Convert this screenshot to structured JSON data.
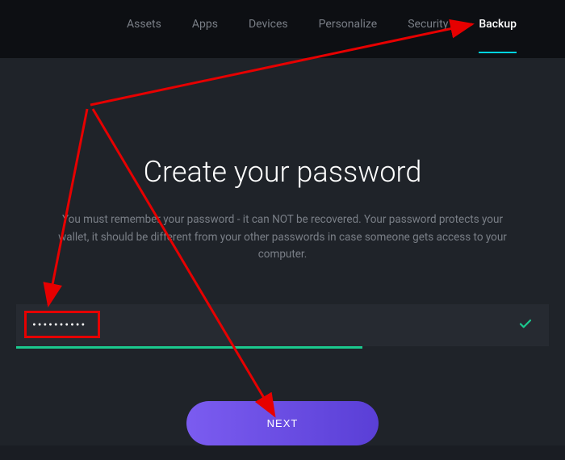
{
  "tabs": {
    "items": [
      {
        "label": "Assets"
      },
      {
        "label": "Apps"
      },
      {
        "label": "Devices"
      },
      {
        "label": "Personalize"
      },
      {
        "label": "Security"
      },
      {
        "label": "Backup"
      }
    ],
    "active_index": 5
  },
  "main": {
    "title": "Create your password",
    "description": "You must remember your password - it can NOT be recovered. Your password protects your wallet, it should be different from your other passwords in case someone gets access to your computer.",
    "password_value": "••••••••••",
    "validation_status": "valid",
    "next_button_label": "NEXT"
  },
  "colors": {
    "accent_teal": "#00d4e0",
    "success_green": "#1bc98e",
    "button_gradient_start": "#7b5cf0",
    "button_gradient_end": "#5a3fd6",
    "annotation_red": "#e60000"
  }
}
